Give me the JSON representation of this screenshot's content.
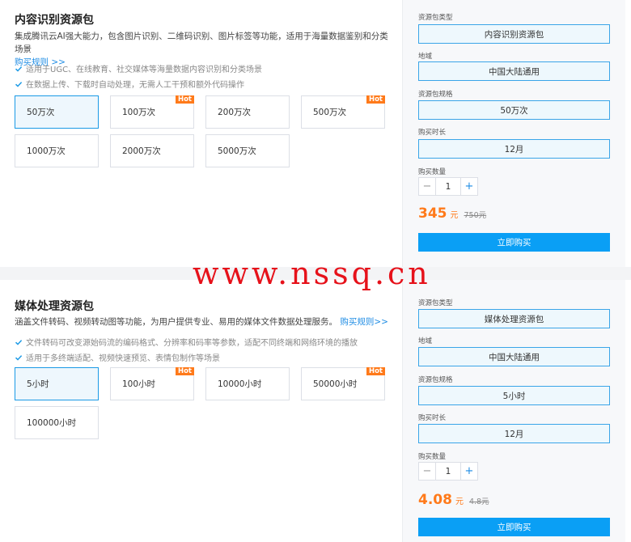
{
  "packages": [
    {
      "title": "内容识别资源包",
      "description": "集成腾讯云AI强大能力，包含图片识别、二维码识别、图片标签等功能，适用于海量数据鉴别和分类场景",
      "rules_link": "购买规则 >>",
      "features": [
        "适用于UGC、在线教育、社交媒体等海量数据内容识别和分类场景",
        "在数据上传、下载时自动处理，无需人工干预和额外代码操作"
      ],
      "options": [
        {
          "label": "50万次",
          "hot": false,
          "selected": true
        },
        {
          "label": "100万次",
          "hot": true,
          "selected": false
        },
        {
          "label": "200万次",
          "hot": false,
          "selected": false
        },
        {
          "label": "500万次",
          "hot": true,
          "selected": false
        },
        {
          "label": "1000万次",
          "hot": false,
          "selected": false
        },
        {
          "label": "2000万次",
          "hot": false,
          "selected": false
        },
        {
          "label": "5000万次",
          "hot": false,
          "selected": false
        }
      ],
      "form": {
        "type_label": "资源包类型",
        "type_value": "内容识别资源包",
        "region_label": "地域",
        "region_value": "中国大陆通用",
        "spec_label": "资源包规格",
        "spec_value": "50万次",
        "duration_label": "购买时长",
        "duration_value": "12月",
        "qty_label": "购买数量",
        "qty_value": "1",
        "minus": "−",
        "plus": "+",
        "price": "345",
        "price_unit": "元",
        "original_price": "750元",
        "buy_label": "立即购买"
      }
    },
    {
      "title": "媒体处理资源包",
      "description": "涵盖文件转码、视频转动图等功能，为用户提供专业、易用的媒体文件数据处理服务。",
      "rules_link": "购买规则>>",
      "features": [
        "文件转码可改变源始码流的编码格式、分辨率和码率等参数，适配不同终端和网络环境的播放",
        "适用于多终端适配、视频快速预览、表情包制作等场景"
      ],
      "options": [
        {
          "label": "5小时",
          "hot": false,
          "selected": true
        },
        {
          "label": "100小时",
          "hot": true,
          "selected": false
        },
        {
          "label": "10000小时",
          "hot": false,
          "selected": false
        },
        {
          "label": "50000小时",
          "hot": true,
          "selected": false
        },
        {
          "label": "100000小时",
          "hot": false,
          "selected": false
        }
      ],
      "form": {
        "type_label": "资源包类型",
        "type_value": "媒体处理资源包",
        "region_label": "地域",
        "region_value": "中国大陆通用",
        "spec_label": "资源包规格",
        "spec_value": "5小时",
        "duration_label": "购买时长",
        "duration_value": "12月",
        "qty_label": "购买数量",
        "qty_value": "1",
        "minus": "−",
        "plus": "+",
        "price": "4.08",
        "price_unit": "元",
        "original_price": "4.8元",
        "buy_label": "立即购买"
      }
    }
  ],
  "hot_badge": "Hot",
  "watermark": "www.nssq.cn",
  "colors": {
    "accent": "#0a9ff5",
    "price": "#ff7a1a",
    "hot": "#ff7a1a",
    "watermark": "#e6111a"
  },
  "icons": {
    "feature": "check-icon"
  }
}
